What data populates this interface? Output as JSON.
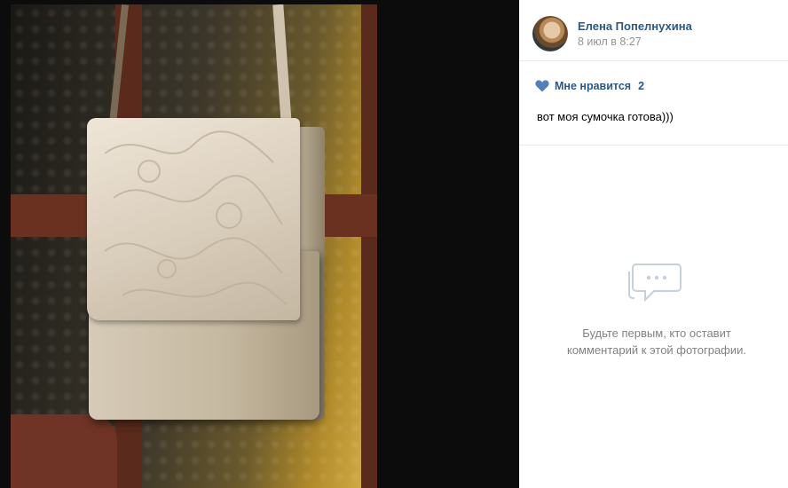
{
  "author": {
    "name": "Елена Попелнухина",
    "date": "8 июл в 8:27"
  },
  "likes": {
    "label": "Мне нравится",
    "count": "2"
  },
  "caption": "вот моя сумочка готова)))",
  "comments": {
    "empty_line1": "Будьте первым, кто оставит",
    "empty_line2": "комментарий к этой фотографии."
  },
  "icons": {
    "like": "heart-icon",
    "empty_comments": "speech-bubble-icon"
  },
  "colors": {
    "link": "#2a5885",
    "muted": "#939393",
    "heart": "#5181b8",
    "empty_icon": "#c5d0db"
  }
}
